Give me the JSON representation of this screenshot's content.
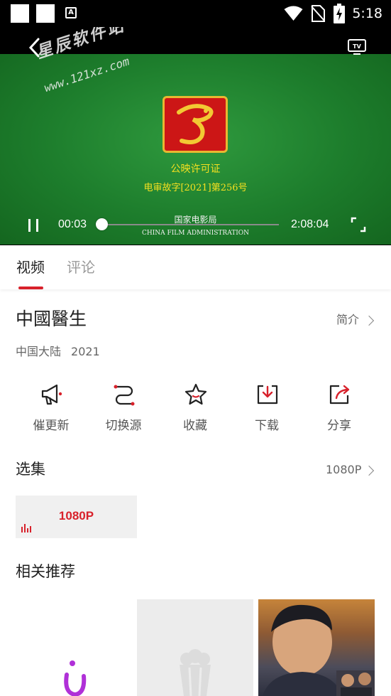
{
  "status_bar": {
    "time": "5:18",
    "icons": [
      "notification-square-icon",
      "notification-square-icon",
      "a-icon",
      "wifi-icon",
      "no-sim-icon",
      "battery-charging-icon"
    ]
  },
  "player": {
    "watermark": "星辰软件站",
    "watermark_url": "www.121xz.com",
    "certificate": {
      "title": "公映许可证",
      "number": "电审故字[2021]第256号",
      "org": "国家电影局",
      "org_en": "CHINA FILM ADMINISTRATION"
    },
    "current_time": "00:03",
    "total_time": "2:08:04",
    "progress": 0.0004,
    "icons": [
      "back-icon",
      "tv-cast-icon",
      "pause-icon",
      "fullscreen-icon"
    ]
  },
  "tabs": [
    {
      "label": "视频",
      "active": true
    },
    {
      "label": "评论",
      "active": false
    }
  ],
  "movie": {
    "title": "中國醫生",
    "intro_label": "简介",
    "region": "中国大陆",
    "year": "2021"
  },
  "actions": [
    {
      "label": "催更新",
      "icon": "megaphone-icon"
    },
    {
      "label": "切换源",
      "icon": "switch-source-icon"
    },
    {
      "label": "收藏",
      "icon": "star-icon"
    },
    {
      "label": "下载",
      "icon": "download-icon"
    },
    {
      "label": "分享",
      "icon": "share-icon"
    }
  ],
  "episodes": {
    "heading": "选集",
    "quality": "1080P",
    "items": [
      {
        "label": "1080P",
        "playing": true
      }
    ]
  },
  "recommend": {
    "heading": "相关推荐"
  },
  "colors": {
    "accent": "#d8212b",
    "certificate_text": "#f5e020",
    "video_green": "#1d7d2c"
  }
}
